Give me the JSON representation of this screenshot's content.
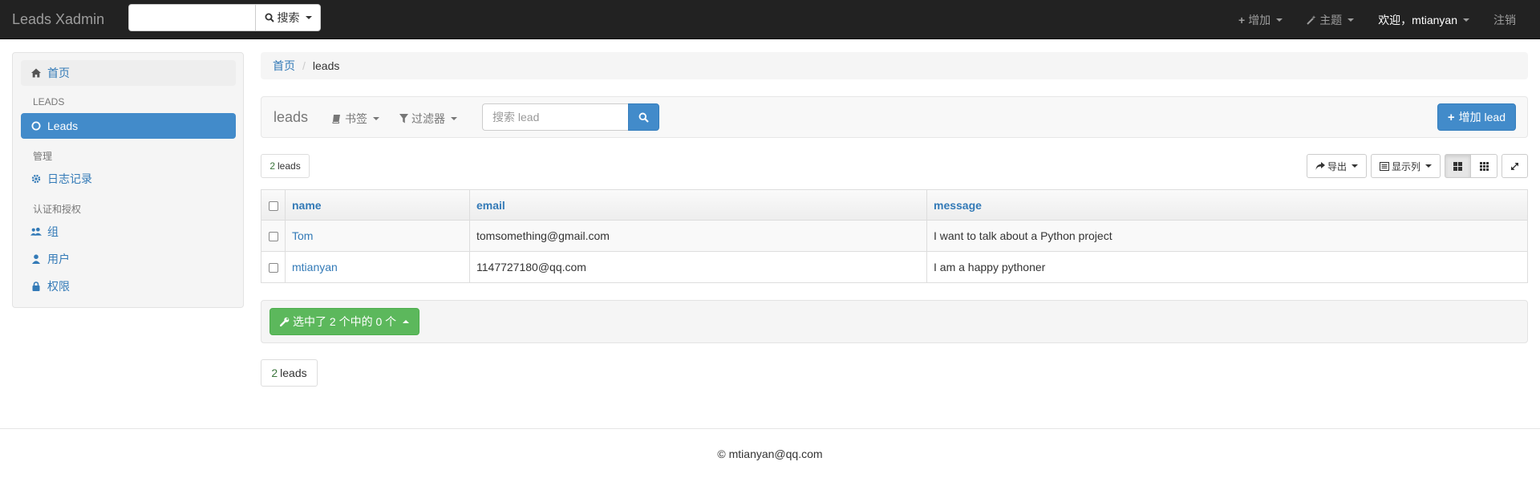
{
  "navbar": {
    "brand": "Leads Xadmin",
    "search_value": "",
    "search_button": "搜索",
    "add_menu": "增加",
    "theme_menu": "主题",
    "welcome": "欢迎，mtianyan",
    "logout": "注销"
  },
  "sidebar": {
    "home": "首页",
    "section_leads": "LEADS",
    "leads": "Leads",
    "section_admin": "管理",
    "log": "日志记录",
    "section_auth": "认证和授权",
    "group": "组",
    "user": "用户",
    "permission": "权限"
  },
  "breadcrumb": {
    "home": "首页",
    "sep": "/",
    "current": "leads"
  },
  "toolbar": {
    "title": "leads",
    "bookmarks": "书签",
    "filters": "过滤器",
    "search_placeholder": "搜索 lead",
    "add_button": "增加 lead"
  },
  "count": {
    "num": "2",
    "label": "leads"
  },
  "tools": {
    "export": "导出",
    "columns": "显示列"
  },
  "table": {
    "columns": [
      "name",
      "email",
      "message"
    ],
    "rows": [
      {
        "name": "Tom",
        "email": "tomsomething@gmail.com",
        "message": "I want to talk about a Python project"
      },
      {
        "name": "mtianyan",
        "email": "1147727180@qq.com",
        "message": "I am a happy pythoner"
      }
    ]
  },
  "actions": {
    "selected": "选中了 2 个中的 0 个"
  },
  "footer": {
    "text": "© mtianyan@qq.com"
  },
  "colors": {
    "navbar": "#222222",
    "primary": "#428bca",
    "success": "#5cb85c",
    "link": "#337ab7"
  }
}
